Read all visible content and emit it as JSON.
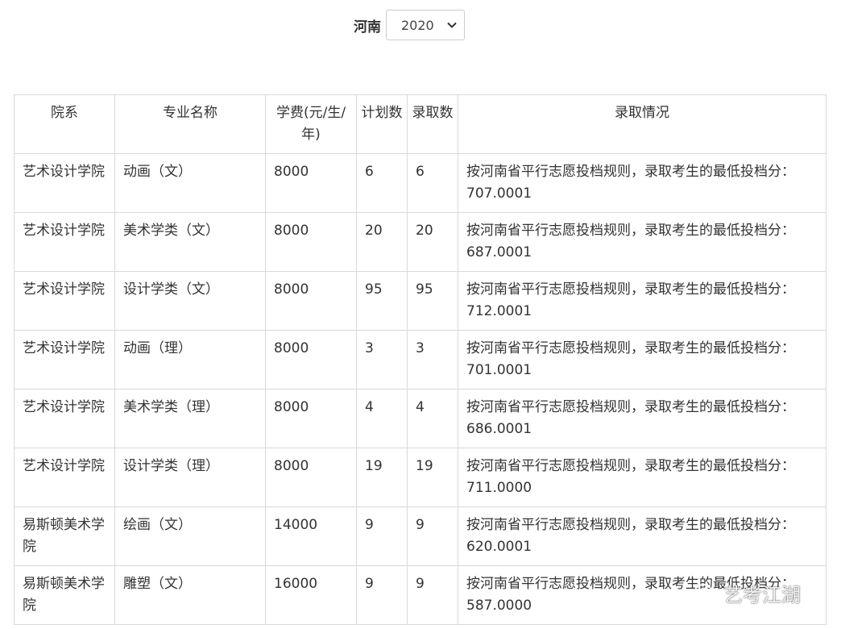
{
  "filter": {
    "province": "河南",
    "year": "2020"
  },
  "table": {
    "headers": {
      "dept": "院系",
      "major": "专业名称",
      "fee": "学费(元/生/年)",
      "plan": "计划数",
      "admit": "录取数",
      "status": "录取情况"
    },
    "rows": [
      {
        "dept": "艺术设计学院",
        "major": "动画（文）",
        "fee": "8000",
        "plan": "6",
        "admit": "6",
        "status": "按河南省平行志愿投档规则，录取考生的最低投档分：707.0001"
      },
      {
        "dept": "艺术设计学院",
        "major": "美术学类（文）",
        "fee": "8000",
        "plan": "20",
        "admit": "20",
        "status": "按河南省平行志愿投档规则，录取考生的最低投档分：687.0001"
      },
      {
        "dept": "艺术设计学院",
        "major": "设计学类（文）",
        "fee": "8000",
        "plan": "95",
        "admit": "95",
        "status": "按河南省平行志愿投档规则，录取考生的最低投档分：712.0001"
      },
      {
        "dept": "艺术设计学院",
        "major": "动画（理）",
        "fee": "8000",
        "plan": "3",
        "admit": "3",
        "status": "按河南省平行志愿投档规则，录取考生的最低投档分：701.0001"
      },
      {
        "dept": "艺术设计学院",
        "major": "美术学类（理）",
        "fee": "8000",
        "plan": "4",
        "admit": "4",
        "status": "按河南省平行志愿投档规则，录取考生的最低投档分：686.0001"
      },
      {
        "dept": "艺术设计学院",
        "major": "设计学类（理）",
        "fee": "8000",
        "plan": "19",
        "admit": "19",
        "status": "按河南省平行志愿投档规则，录取考生的最低投档分：711.0000"
      },
      {
        "dept": "易斯顿美术学院",
        "major": "绘画（文）",
        "fee": "14000",
        "plan": "9",
        "admit": "9",
        "status": "按河南省平行志愿投档规则，录取考生的最低投档分：620.0001"
      },
      {
        "dept": "易斯顿美术学院",
        "major": "雕塑（文）",
        "fee": "16000",
        "plan": "9",
        "admit": "9",
        "status": "按河南省平行志愿投档规则，录取考生的最低投档分：587.0000"
      }
    ]
  },
  "watermark": {
    "text": "艺考江湖",
    "icon": "wechat-icon"
  },
  "colors": {
    "border": "#d9d9d9",
    "text": "#333333"
  }
}
